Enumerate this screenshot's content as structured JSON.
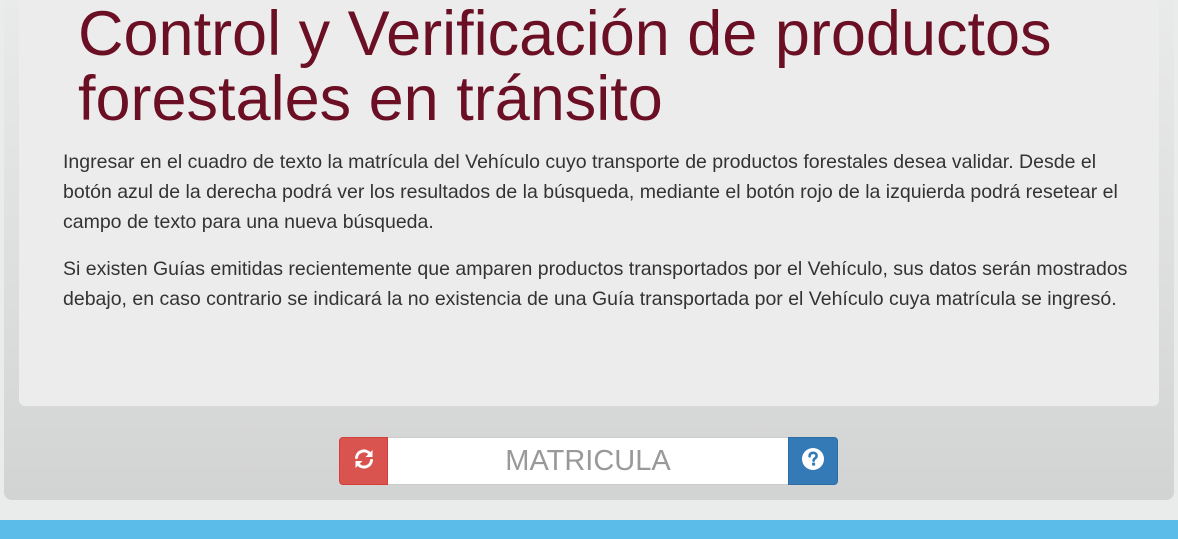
{
  "header": {
    "title": "Control y Verificación de productos forestales en tránsito"
  },
  "content": {
    "paragraph_1": "Ingresar en el cuadro de texto la matrícula del Vehículo cuyo transporte de productos forestales desea validar. Desde el botón azul de la derecha podrá ver los resultados de la búsqueda, mediante el botón rojo de la izquierda podrá resetear el campo de texto para una nueva búsqueda.",
    "paragraph_2": "Si existen Guías emitidas recientemente que amparen productos transportados por el Vehículo, sus datos serán mostrados debajo, en caso contrario se indicará la no existencia de una Guía transportada por el Vehículo cuya matrícula se ingresó."
  },
  "search": {
    "placeholder": "MATRICULA",
    "value": "",
    "reset_icon": "refresh-icon",
    "help_icon": "question-circle-icon"
  },
  "colors": {
    "title": "#6a0f24",
    "reset_button": "#d9534f",
    "help_button": "#337ab7",
    "bottom_bar": "#5bbcea"
  }
}
